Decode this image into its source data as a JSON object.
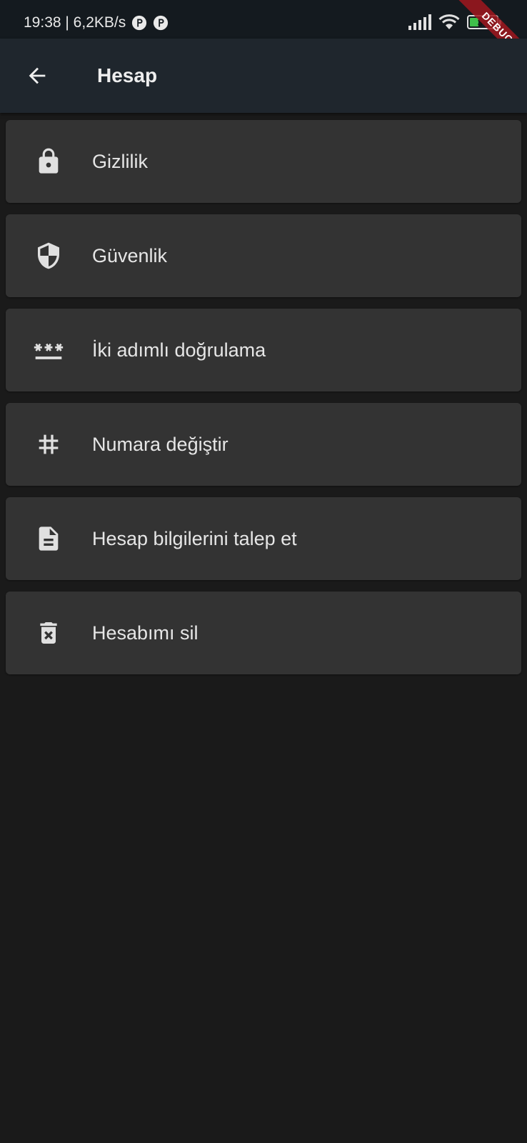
{
  "status_bar": {
    "time_speed": "19:38 | 6,2KB/s",
    "battery_level": "34",
    "battery_fraction": 0.34
  },
  "debug_banner": "DEBUG",
  "app_bar": {
    "title": "Hesap",
    "back_icon": "arrow-back-icon"
  },
  "items": [
    {
      "label": "Gizlilik",
      "icon": "lock-icon"
    },
    {
      "label": "Güvenlik",
      "icon": "shield-icon"
    },
    {
      "label": "İki adımlı doğrulama",
      "icon": "password-icon"
    },
    {
      "label": "Numara değiştir",
      "icon": "hashtag-icon"
    },
    {
      "label": "Hesap bilgilerini talep et",
      "icon": "document-icon"
    },
    {
      "label": "Hesabımı sil",
      "icon": "delete-icon"
    }
  ],
  "colors": {
    "background": "#1a1a1a",
    "app_bar": "#1f262d",
    "card": "#333333",
    "icon": "#e0e0e0",
    "text": "#e6e6e6",
    "battery_green": "#3fbf4a"
  }
}
